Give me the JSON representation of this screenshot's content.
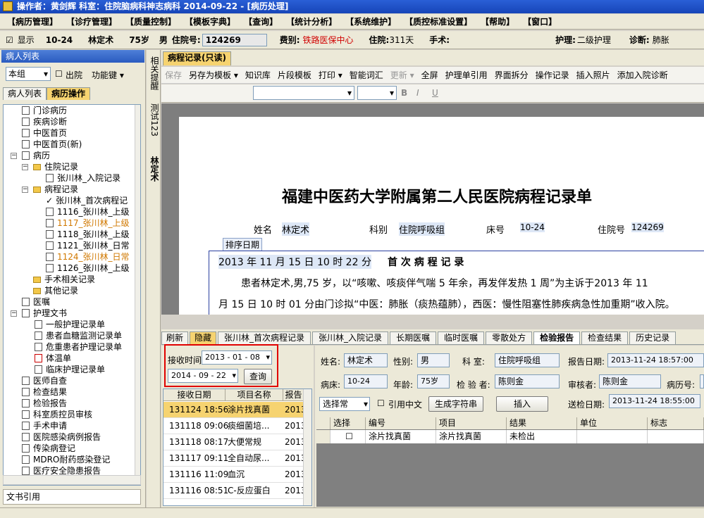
{
  "titlebar": {
    "text": "操作者：黄剑辉    科室：住院脑病科神志病科    2014-09-22 - [病历处理]"
  },
  "menu": [
    "【病历管理】",
    "【诊疗管理】",
    "【质量控制】",
    "【模板字典】",
    "【查询】",
    "【统计分析】",
    "【系统维护】",
    "【质控标准设置】",
    "【帮助】",
    "【窗口】"
  ],
  "patient": {
    "show_label": "显示",
    "bed": "10-24",
    "name": "林定术",
    "age": "75岁",
    "gender": "男",
    "inpatient_no_label": "住院号:",
    "inpatient_no": "124269",
    "fee_label": "费别:",
    "fee": "铁路医保中心",
    "stay_label": "住院:",
    "stay": "311天",
    "surgery_label": "手术:",
    "care_label": "护理:",
    "care": "二级护理",
    "diag_label": "诊断:",
    "diag": "肺胀"
  },
  "left": {
    "header": "病人列表",
    "group": "本组",
    "discharged": "出院",
    "function": "功能键",
    "tabs": [
      "病人列表",
      "病历操作"
    ],
    "bottom": "文书引用",
    "tree": [
      "门诊病历",
      "疾病诊断",
      "中医首页",
      "中医首页(新)",
      "病历",
      "住院记录",
      "张川林_入院记录",
      "病程记录",
      "张川林_首次病程记",
      "1116_张川林_上级",
      "1117_张川林_上级",
      "1118_张川林_上级",
      "1121_张川林_日常",
      "1124_张川林_日常",
      "1126_张川林_上级",
      "手术相关记录",
      "其他记录",
      "医嘱",
      "护理文书",
      "一般护理记录单",
      "患者血糖监测记录单",
      "危重患者护理记录单",
      "体温单",
      "临床护理记录单",
      "医师自查",
      "检查结果",
      "检验报告",
      "科室质控员审核",
      "手术申请",
      "医院感染病例报告",
      "传染病登记",
      "MDRO耐药感染登记",
      "医疗安全隐患报告"
    ]
  },
  "strip": [
    "相关提醒",
    "测试123",
    "林定术"
  ],
  "editor": {
    "tab": "病程记录(只读)",
    "toolbar": [
      "保存",
      "另存为模板 ▾",
      "知识库",
      "片段模板",
      "打印 ▾",
      "智能词汇",
      "更新 ▾",
      "全屏",
      "护理单引用",
      "界面拆分",
      "操作记录",
      "插入照片",
      "添加入院诊断"
    ],
    "doc": {
      "title": "福建中医药大学附属第二人民医院病程记录单",
      "name_label": "姓名",
      "name": "林定术",
      "dept_label": "科别",
      "dept": "住院呼吸组",
      "bed_label": "床号",
      "bed": "10-24",
      "no_label": "住院号",
      "no": "124269",
      "sort_label": "排序日期",
      "datetime": "2013 年 11 月 15 日 10 时 22 分",
      "heading": "首 次 病 程 记 录",
      "line1": "患者林定术,男,75 岁，以“咳嗽、咳痰伴气喘 5 年余，再发伴发热 1 周”为主诉于2013 年 11",
      "line2": "月 15 日 10 时 01 分由门诊拟“中医：肺胀（痰热蕴肺），西医：慢性阻塞性肺疾病急性加重期”收入院。"
    }
  },
  "lower": {
    "tabs": [
      "刷新",
      "隐藏",
      "张川林_首次病程记录",
      "张川林_入院记录",
      "长期医嘱",
      "临时医嘱",
      "零散处方",
      "检验报告",
      "检查结果",
      "历史记录"
    ],
    "recv_label": "接收时间",
    "date_from": "2013 - 01 - 08",
    "date_to": "2014 - 09 - 22",
    "query": "查询",
    "grid_headers": [
      "接收日期",
      "项目名称",
      "报告"
    ],
    "rows": [
      [
        "131124 18:56",
        "涂片找真菌",
        "2013"
      ],
      [
        "131118 09:06",
        "痰细菌培...",
        "2013"
      ],
      [
        "131118 08:17",
        "大便常规",
        "2013"
      ],
      [
        "131117 09:11",
        "全自动尿...",
        "2013"
      ],
      [
        "131116 11:09",
        "血沉",
        "2013"
      ],
      [
        "131116 08:51",
        "C-反应蛋白",
        "2013"
      ]
    ],
    "detail": {
      "name_label": "姓名:",
      "name": "林定术",
      "sex_label": "性别:",
      "sex": "男",
      "dept_label": "科  室:",
      "dept": "住院呼吸组",
      "report_date_label": "报告日期:",
      "report_date": "2013-11-24 18:57:00",
      "bed_label": "病床:",
      "bed": "10-24",
      "age_label": "年龄:",
      "age": "75岁",
      "inspector_label": "检 验 者:",
      "inspector": "陈则金",
      "reviewer_label": "审核者:",
      "reviewer": "陈则金",
      "caseno_label": "病历号:",
      "select": "选择常",
      "cite_cn": "引用中文",
      "gen_btn": "生成字符串",
      "insert_btn": "插入",
      "send_date_label": "送检日期:",
      "send_date": "2013-11-24 18:55:00"
    },
    "result_headers": [
      "选择",
      "编号",
      "项目",
      "结果",
      "单位",
      "标志"
    ],
    "result_row": [
      "",
      "涂片找真菌",
      "涂片找真菌",
      "未检出",
      "",
      ""
    ]
  }
}
